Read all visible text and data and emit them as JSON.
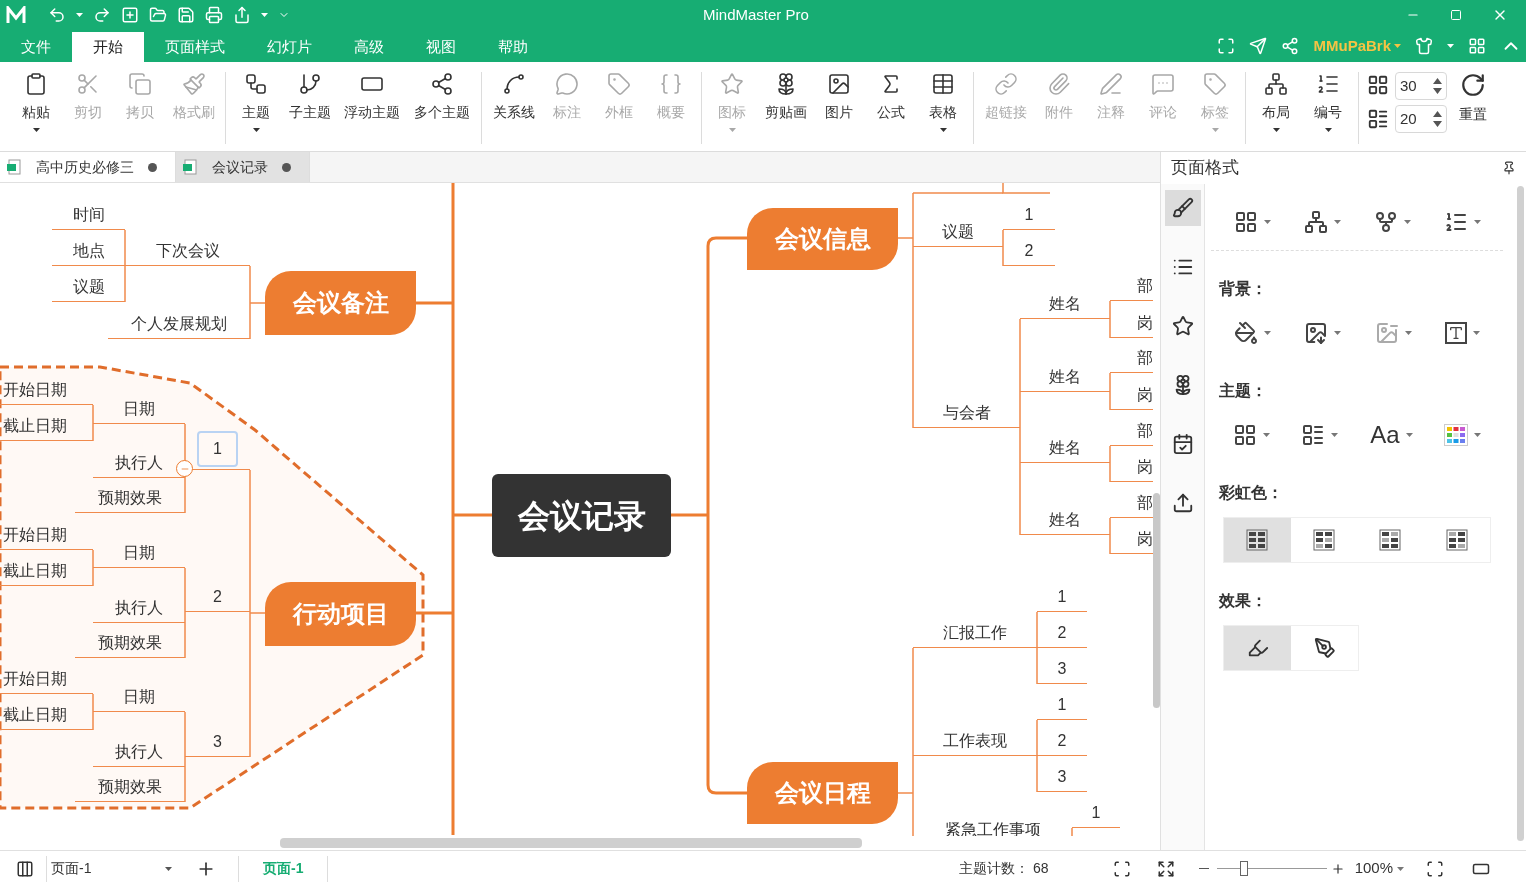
{
  "window": {
    "title": "MindMaster Pro"
  },
  "menu_tabs": [
    {
      "label": "文件",
      "selected": false
    },
    {
      "label": "开始",
      "selected": true
    },
    {
      "label": "页面样式",
      "selected": false
    },
    {
      "label": "幻灯片",
      "selected": false
    },
    {
      "label": "高级",
      "selected": false
    },
    {
      "label": "视图",
      "selected": false
    },
    {
      "label": "帮助",
      "selected": false
    }
  ],
  "account": {
    "name": "MMuPaBrk"
  },
  "toolbar": {
    "groups": [
      [
        {
          "label": "粘贴",
          "disabled": false,
          "dropdown": true
        },
        {
          "label": "剪切",
          "disabled": true,
          "dropdown": false
        },
        {
          "label": "拷贝",
          "disabled": true,
          "dropdown": false
        },
        {
          "label": "格式刷",
          "disabled": true,
          "dropdown": false
        }
      ],
      [
        {
          "label": "主题",
          "disabled": false,
          "dropdown": true
        },
        {
          "label": "子主题",
          "disabled": false,
          "dropdown": false
        },
        {
          "label": "浮动主题",
          "disabled": false,
          "dropdown": false
        },
        {
          "label": "多个主题",
          "disabled": false,
          "dropdown": false
        }
      ],
      [
        {
          "label": "关系线",
          "disabled": false,
          "dropdown": false
        },
        {
          "label": "标注",
          "disabled": true,
          "dropdown": false
        },
        {
          "label": "外框",
          "disabled": true,
          "dropdown": false
        },
        {
          "label": "概要",
          "disabled": true,
          "dropdown": false
        }
      ],
      [
        {
          "label": "图标",
          "disabled": true,
          "dropdown": true
        },
        {
          "label": "剪贴画",
          "disabled": false,
          "dropdown": false
        },
        {
          "label": "图片",
          "disabled": false,
          "dropdown": false
        },
        {
          "label": "公式",
          "disabled": false,
          "dropdown": false
        },
        {
          "label": "表格",
          "disabled": false,
          "dropdown": true
        }
      ],
      [
        {
          "label": "超链接",
          "disabled": true,
          "dropdown": false
        },
        {
          "label": "附件",
          "disabled": true,
          "dropdown": false
        },
        {
          "label": "注释",
          "disabled": true,
          "dropdown": false
        },
        {
          "label": "评论",
          "disabled": true,
          "dropdown": false
        },
        {
          "label": "标签",
          "disabled": true,
          "dropdown": true
        }
      ],
      [
        {
          "label": "布局",
          "disabled": false,
          "dropdown": true
        },
        {
          "label": "编号",
          "disabled": false,
          "dropdown": true
        }
      ]
    ],
    "spacing": [
      {
        "value": "30"
      },
      {
        "value": "20"
      }
    ],
    "reset": "重置"
  },
  "doc_tabs": [
    {
      "label": "高中历史必修三",
      "selected": false
    },
    {
      "label": "会议记录",
      "selected": true
    }
  ],
  "mindmap": {
    "root": {
      "text": "会议记录",
      "selected": false,
      "children": [
        {
          "text": "会议备注",
          "selected": false,
          "children": [
            {
              "text": "下次会议",
              "selected": false,
              "children": [
                {
                  "text": "时间",
                  "selected": false
                },
                {
                  "text": "地点",
                  "selected": false
                },
                {
                  "text": "议题",
                  "selected": false
                }
              ]
            },
            {
              "text": "个人发展规划",
              "selected": false
            }
          ]
        },
        {
          "text": "行动项目",
          "selected": false,
          "children": [
            {
              "text": "1",
              "selected": true,
              "children": [
                {
                  "text": "日期",
                  "selected": false,
                  "children": [
                    {
                      "text": "开始日期",
                      "selected": false
                    },
                    {
                      "text": "截止日期",
                      "selected": false
                    }
                  ]
                },
                {
                  "text": "执行人",
                  "selected": false
                },
                {
                  "text": "预期效果",
                  "selected": false
                }
              ]
            },
            {
              "text": "2",
              "selected": false,
              "children": [
                {
                  "text": "日期",
                  "selected": false,
                  "children": [
                    {
                      "text": "开始日期",
                      "selected": false
                    },
                    {
                      "text": "截止日期",
                      "selected": false
                    }
                  ]
                },
                {
                  "text": "执行人",
                  "selected": false
                },
                {
                  "text": "预期效果",
                  "selected": false
                }
              ]
            },
            {
              "text": "3",
              "selected": false,
              "children": [
                {
                  "text": "日期",
                  "selected": false,
                  "children": [
                    {
                      "text": "开始日期",
                      "selected": false
                    },
                    {
                      "text": "截止日期",
                      "selected": false
                    }
                  ]
                },
                {
                  "text": "执行人",
                  "selected": false
                },
                {
                  "text": "预期效果",
                  "selected": false
                }
              ]
            }
          ]
        },
        {
          "text": "会议信息",
          "selected": false,
          "children": [
            {
              "text": "议题",
              "selected": false,
              "children": [
                {
                  "text": "1",
                  "selected": false
                },
                {
                  "text": "2",
                  "selected": false
                }
              ]
            },
            {
              "text": "与会者",
              "selected": false,
              "children": [
                {
                  "text": "姓名",
                  "selected": false,
                  "children": [
                    {
                      "text": "部",
                      "selected": false
                    },
                    {
                      "text": "岗",
                      "selected": false
                    }
                  ]
                },
                {
                  "text": "姓名",
                  "selected": false,
                  "children": [
                    {
                      "text": "部",
                      "selected": false
                    },
                    {
                      "text": "岗",
                      "selected": false
                    }
                  ]
                },
                {
                  "text": "姓名",
                  "selected": false,
                  "children": [
                    {
                      "text": "部",
                      "selected": false
                    },
                    {
                      "text": "岗",
                      "selected": false
                    }
                  ]
                },
                {
                  "text": "姓名",
                  "selected": false,
                  "children": [
                    {
                      "text": "部",
                      "selected": false
                    },
                    {
                      "text": "岗",
                      "selected": false
                    }
                  ]
                }
              ]
            }
          ]
        },
        {
          "text": "会议日程",
          "selected": false,
          "children": [
            {
              "text": "汇报工作",
              "selected": false,
              "children": [
                {
                  "text": "1",
                  "selected": false
                },
                {
                  "text": "2",
                  "selected": false
                },
                {
                  "text": "3",
                  "selected": false
                }
              ]
            },
            {
              "text": "工作表现",
              "selected": false,
              "children": [
                {
                  "text": "1",
                  "selected": false
                },
                {
                  "text": "2",
                  "selected": false
                },
                {
                  "text": "3",
                  "selected": false
                }
              ]
            },
            {
              "text": "紧急工作事项",
              "selected": false,
              "children": [
                {
                  "text": "1",
                  "selected": false
                }
              ]
            }
          ]
        }
      ]
    }
  },
  "panel": {
    "title": "页面格式",
    "side_tabs": [
      {
        "selected": true
      },
      {
        "selected": false
      },
      {
        "selected": false
      },
      {
        "selected": false
      },
      {
        "selected": false
      },
      {
        "selected": false
      }
    ],
    "background_label": "背景：",
    "theme_label": "主题：",
    "theme_font": "Aa",
    "rainbow_label": "彩虹色：",
    "rainbow_options": [
      {
        "selected": true
      },
      {
        "selected": false
      },
      {
        "selected": false
      },
      {
        "selected": false
      }
    ],
    "effect_label": "效果：",
    "effect_options": [
      {
        "selected": true
      },
      {
        "selected": false
      }
    ]
  },
  "status_bar": {
    "page_select": "页面-1",
    "page_tab": "页面-1",
    "count_label": "主题计数：",
    "count": "68",
    "zoom": {
      "level": 0.25,
      "reading": "100%"
    }
  }
}
